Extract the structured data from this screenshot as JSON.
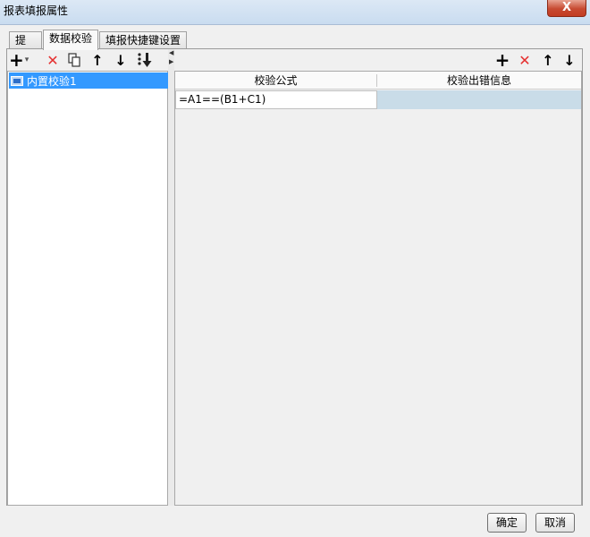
{
  "window": {
    "title": "报表填报属性",
    "close_label": "X"
  },
  "tabs": [
    {
      "label": "提交"
    },
    {
      "label": "数据校验"
    },
    {
      "label": "填报快捷键设置"
    }
  ],
  "left_toolbar": {
    "add": "+",
    "add_arrow": "▾",
    "delete": "✕",
    "up": "↑",
    "down": "↓"
  },
  "left_list": {
    "items": [
      {
        "label": "内置校验1"
      }
    ]
  },
  "right_toolbar": {
    "add": "+",
    "delete": "✕",
    "up": "↑",
    "down": "↓"
  },
  "grid": {
    "columns": [
      "校验公式",
      "校验出错信息"
    ],
    "rows": [
      {
        "formula": "=A1==(B1+C1)",
        "message": ""
      }
    ]
  },
  "footer": {
    "ok": "确定",
    "cancel": "取消"
  },
  "colors": {
    "accent": "#3399ff",
    "delete": "#e53030",
    "close": "#c74a31",
    "selected_cell": "#c9dce8"
  }
}
